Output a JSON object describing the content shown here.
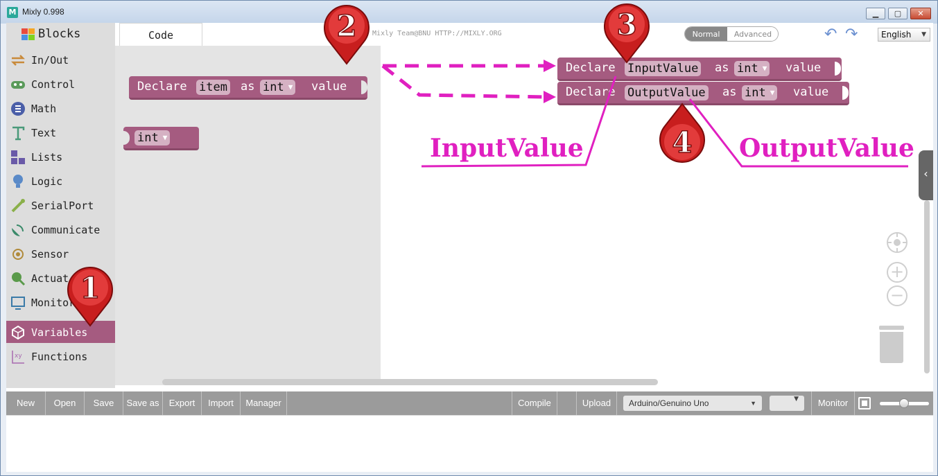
{
  "window": {
    "title": "Mixly 0.998"
  },
  "header": {
    "blocks_tab": "Blocks",
    "code_tab": "Code",
    "credit": "© Mixly Team@BNU HTTP://MIXLY.ORG",
    "mode_normal": "Normal",
    "mode_advanced": "Advanced",
    "language": "English"
  },
  "sidebar": {
    "items": [
      {
        "label": "In/Out",
        "icon": "in-out-arrows-icon"
      },
      {
        "label": "Control",
        "icon": "gamepad-icon"
      },
      {
        "label": "Math",
        "icon": "math-sigma-icon"
      },
      {
        "label": "Text",
        "icon": "text-t-icon"
      },
      {
        "label": "Lists",
        "icon": "lists-blocks-icon"
      },
      {
        "label": "Logic",
        "icon": "lightbulb-icon"
      },
      {
        "label": "SerialPort",
        "icon": "serial-pen-icon"
      },
      {
        "label": "Communicate",
        "icon": "satellite-dish-icon"
      },
      {
        "label": "Sensor",
        "icon": "sensor-signal-icon"
      },
      {
        "label": "Actuat",
        "icon": "actuator-pin-icon"
      },
      {
        "label": "Monitor",
        "icon": "monitor-icon"
      },
      {
        "label": "Variables",
        "icon": "unity-cube-icon"
      },
      {
        "label": "Functions",
        "icon": "function-xy-icon"
      }
    ]
  },
  "flyout": {
    "declare_block": {
      "declare": "Declare",
      "var": "item",
      "as": "as",
      "type": "int",
      "value": "value"
    },
    "type_block": {
      "type": "int"
    }
  },
  "workspace": {
    "block1": {
      "declare": "Declare",
      "var": "InputValue",
      "as": "as",
      "type": "int",
      "value": "value"
    },
    "block2": {
      "declare": "Declare",
      "var": "OutputValue",
      "as": "as",
      "type": "int",
      "value": "value"
    }
  },
  "annotations": {
    "label_input": "InputValue",
    "label_output": "OutputValue",
    "pins": [
      "1",
      "2",
      "3",
      "4"
    ],
    "color": "#e020c0",
    "pin_color": "#c81e1e"
  },
  "toolbar": {
    "new": "New",
    "open": "Open",
    "save": "Save",
    "save_as": "Save as",
    "export": "Export",
    "import": "Import",
    "manager": "Manager",
    "compile": "Compile",
    "upload": "Upload",
    "board": "Arduino/Genuino Uno",
    "port": "",
    "monitor": "Monitor"
  },
  "colors": {
    "variables": "#a55b80",
    "toolbar": "#9b9b9b"
  }
}
